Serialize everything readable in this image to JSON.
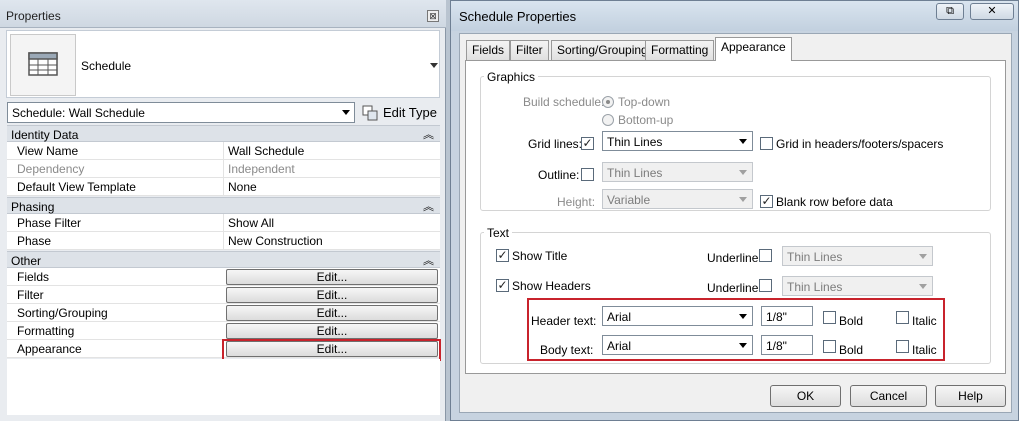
{
  "properties": {
    "title": "Properties",
    "close_glyph": "⊠",
    "type_name": "Schedule",
    "type_icon": "schedule-table-icon",
    "type_selector_value": "Schedule: Wall Schedule",
    "edit_type_label": "Edit Type",
    "groups": [
      {
        "name": "Identity Data",
        "rows": [
          {
            "key": "View Name",
            "value": "Wall Schedule"
          },
          {
            "key": "Dependency",
            "value": "Independent"
          },
          {
            "key": "Default View Template",
            "value": "None"
          }
        ]
      },
      {
        "name": "Phasing",
        "rows": [
          {
            "key": "Phase Filter",
            "value": "Show All"
          },
          {
            "key": "Phase",
            "value": "New Construction"
          }
        ]
      },
      {
        "name": "Other",
        "rows": [
          {
            "key": "Fields",
            "value": "Edit..."
          },
          {
            "key": "Filter",
            "value": "Edit..."
          },
          {
            "key": "Sorting/Grouping",
            "value": "Edit..."
          },
          {
            "key": "Formatting",
            "value": "Edit..."
          },
          {
            "key": "Appearance",
            "value": "Edit..."
          }
        ]
      }
    ],
    "collapse_glyph": "≈"
  },
  "dialog": {
    "title": "Schedule Properties",
    "close_glyph": "✕",
    "restore_glyph": "⧉",
    "tabs": [
      "Fields",
      "Filter",
      "Sorting/Grouping",
      "Formatting",
      "Appearance"
    ],
    "active_tab": "Appearance",
    "graphics": {
      "legend": "Graphics",
      "build_schedule_label": "Build schedule:",
      "top_down": "Top-down",
      "bottom_up": "Bottom-up",
      "grid_lines_label": "Grid lines:",
      "grid_lines_checked": true,
      "grid_lines_value": "Thin Lines",
      "grid_in_headers_label": "Grid in headers/footers/spacers",
      "outline_label": "Outline:",
      "outline_value": "Thin Lines",
      "height_label": "Height:",
      "height_value": "Variable",
      "blank_row_label": "Blank row before data",
      "blank_row_checked": true
    },
    "text": {
      "legend": "Text",
      "show_title_label": "Show Title",
      "show_headers_label": "Show Headers",
      "underline_label": "Underline:",
      "underline_value": "Thin Lines",
      "header_text_label": "Header text:",
      "header_font": "Arial",
      "header_size": "1/8\"",
      "body_text_label": "Body text:",
      "body_font": "Arial",
      "body_size": "1/8\"",
      "bold_label": "Bold",
      "italic_label": "Italic"
    },
    "buttons": {
      "ok": "OK",
      "cancel": "Cancel",
      "help": "Help"
    },
    "check_glyph": "✓"
  },
  "colors": {
    "highlight": "#c8232c"
  }
}
